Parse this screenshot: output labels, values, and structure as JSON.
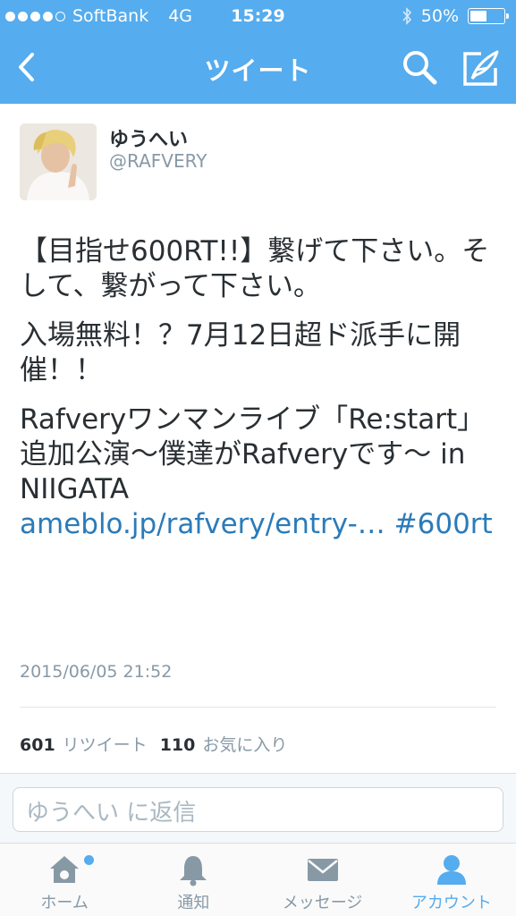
{
  "status_bar": {
    "carrier": "SoftBank",
    "network": "4G",
    "time": "15:29",
    "battery": "50%",
    "signal_bars_filled": 4,
    "battery_level": 0.5
  },
  "nav": {
    "title": "ツイート"
  },
  "tweet": {
    "user_name": "ゆうへい",
    "handle": "@RAFVERY",
    "paragraph1": "【目指せ600RT!!】繋げて下さい。そして、繋がって下さい。",
    "paragraph2": "入場無料！？7月12日超ド派手に開催！！",
    "paragraph3": "Rafveryワンマンライブ「Re:start」追加公演〜僕達がRafveryです〜 in NIIGATA",
    "link": "ameblo.jp/rafvery/entry-…",
    "hashtag": "#600rt",
    "timestamp": "2015/06/05 21:52",
    "retweet_count": "601",
    "retweet_label": "リツイート",
    "favorite_count": "110",
    "favorite_label": "お気に入り"
  },
  "reply": {
    "placeholder": "ゆうへい に返信"
  },
  "tabbar": {
    "home": "ホーム",
    "notifications": "通知",
    "messages": "メッセージ",
    "account": "アカウント"
  },
  "colors": {
    "brand": "#55acee",
    "link": "#2b7bb9",
    "muted": "#8899a6",
    "text": "#292f33"
  }
}
